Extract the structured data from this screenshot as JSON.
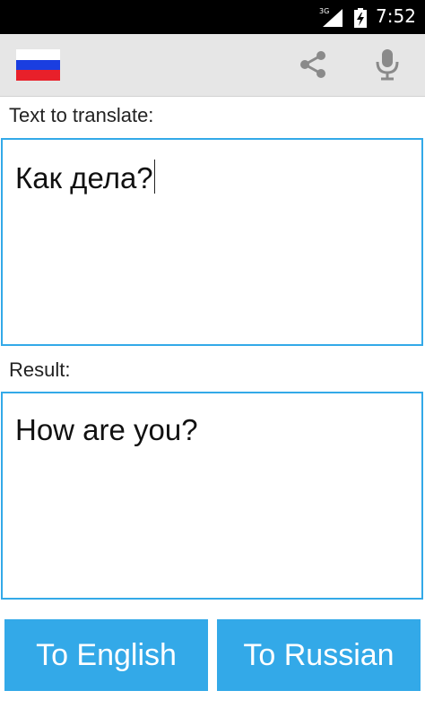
{
  "status_bar": {
    "network": "3G",
    "time": "7:52"
  },
  "action_bar": {
    "flag_icon": "russia-flag-icon",
    "flag_colors": [
      "#ffffff",
      "#1a3ee0",
      "#e8202a"
    ],
    "share_icon": "share-icon",
    "mic_icon": "microphone-icon",
    "icon_color": "#8a8a8a"
  },
  "source": {
    "label": "Text to translate:",
    "value": "Как дела?"
  },
  "result": {
    "label": "Result:",
    "value": "How are you?"
  },
  "buttons": {
    "to_english": "To English",
    "to_russian": "To Russian"
  },
  "colors": {
    "accent": "#33a9e8",
    "toolbar_bg": "#e6e6e6",
    "status_bg": "#000000"
  }
}
